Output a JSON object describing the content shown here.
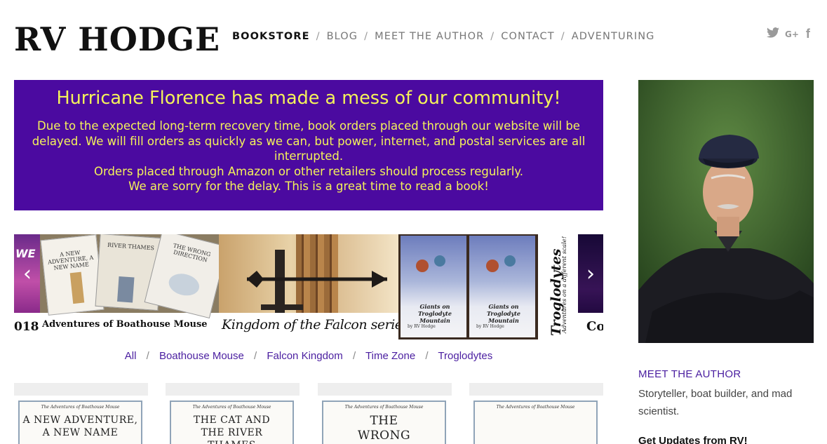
{
  "site": {
    "logo": "RV HODGE"
  },
  "nav": {
    "items": [
      {
        "label": "BOOKSTORE",
        "active": true
      },
      {
        "label": "BLOG"
      },
      {
        "label": "MEET THE AUTHOR"
      },
      {
        "label": "CONTACT"
      },
      {
        "label": "ADVENTURING"
      }
    ],
    "separator": "/"
  },
  "social": {
    "icons": [
      "twitter-icon",
      "google-plus-icon",
      "facebook-icon"
    ],
    "gplus_text": "G+",
    "fb_text": "f"
  },
  "banner": {
    "title": "Hurricane Florence has made a mess of our community!",
    "body": [
      "Due to the expected long-term recovery time, book orders placed through our website will be delayed. We will fill orders as quickly as we can, but power, internet, and postal services are all interrupted.",
      "Orders placed through Amazon or other retailers should process regularly.",
      "We are sorry for the delay. This is a great time to read a book!"
    ],
    "bg_color": "#4b0aa0",
    "text_color": "#f4f25a"
  },
  "carousel": {
    "captions": {
      "left_fragment": "018",
      "boathouse": "Adventures of Boathouse Mouse",
      "falcon": "Kingdom of the Falcon series",
      "troglodytes_title": "Troglodytes",
      "troglodytes_tag": "Adventures on a different scale!",
      "right_fragment": "Co"
    },
    "book_cover_titles": [
      "A NEW ADVENTURE, A NEW NAME",
      "RIVER THAMES",
      "THE WRONG DIRECTION"
    ],
    "giants": {
      "title": "Giants on Troglodyte Mountain",
      "author": "by RV Hodge"
    },
    "left_fragment_text": "WE",
    "prev_label": "‹",
    "next_label": "›"
  },
  "filters": {
    "items": [
      "All",
      "Boathouse Mouse",
      "Falcon Kingdom",
      "Time Zone",
      "Troglodytes"
    ],
    "separator": "/"
  },
  "grid": {
    "series_label": "The Adventures of Boathouse Mouse",
    "cards": [
      {
        "title": "A NEW ADVENTURE, A NEW NAME"
      },
      {
        "title": "THE CAT AND THE RIVER THAMES"
      },
      {
        "title": "THE WRONG DIRECTION"
      },
      {
        "title": ""
      }
    ]
  },
  "sidebar": {
    "heading": "MEET THE AUTHOR",
    "text": "Storyteller, boat builder, and mad scientist.",
    "updates_heading": "Get Updates from RV!"
  }
}
